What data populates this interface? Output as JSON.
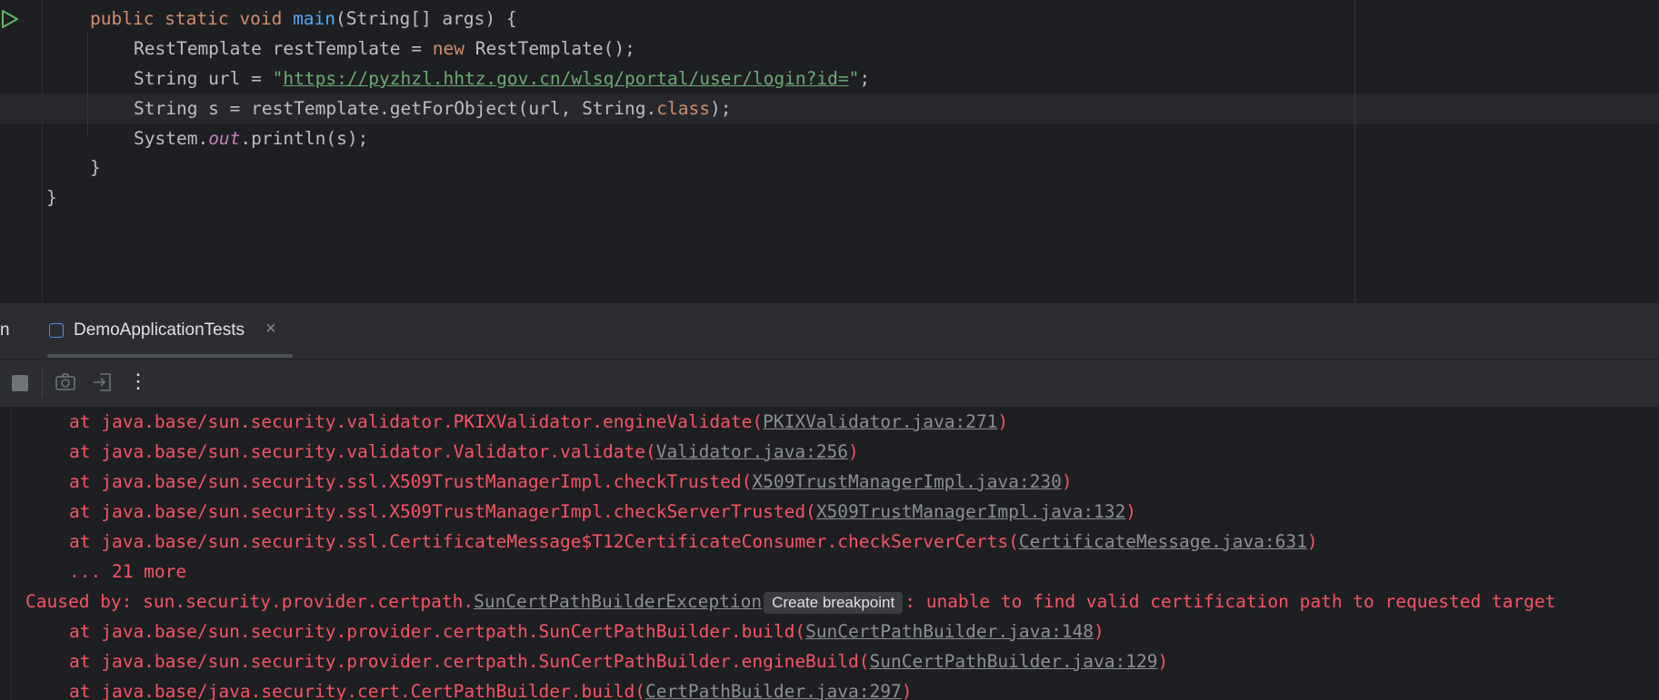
{
  "editor": {
    "lines": [
      {
        "p1": "public static void ",
        "fn": "main",
        "p2": "(String[] args) {"
      },
      {
        "p1": "RestTemplate restTemplate = ",
        "kw": "new",
        "p2": " RestTemplate();"
      },
      {
        "p1": "String url = ",
        "q1": "\"",
        "url": "https://pyzhzl.hhtz.gov.cn/wlsq/portal/user/login?id=",
        "q2": "\"",
        "p2": ";"
      },
      {
        "p1": "String s = restTemplate.getForObject(url, String.",
        "kw": "class",
        "p2": ");"
      },
      {
        "p1": "System.",
        "field": "out",
        "p2": ".println(s);"
      },
      {
        "p1": "}"
      },
      {
        "p1": "}"
      }
    ]
  },
  "run_panel": {
    "cut_tab_label": "n",
    "tab_label": "DemoApplicationTests",
    "tab_close": "×",
    "more_label": "⋮"
  },
  "console": {
    "lines": [
      {
        "pre": "at java.base/sun.security.validator.PKIXValidator.engineValidate(",
        "link": "PKIXValidator.java:271",
        "post": ")"
      },
      {
        "pre": "at java.base/sun.security.validator.Validator.validate(",
        "link": "Validator.java:256",
        "post": ")"
      },
      {
        "pre": "at java.base/sun.security.ssl.X509TrustManagerImpl.checkTrusted(",
        "link": "X509TrustManagerImpl.java:230",
        "post": ")"
      },
      {
        "pre": "at java.base/sun.security.ssl.X509TrustManagerImpl.checkServerTrusted(",
        "link": "X509TrustManagerImpl.java:132",
        "post": ")"
      },
      {
        "pre": "at java.base/sun.security.ssl.CertificateMessage$T12CertificateConsumer.checkServerCerts(",
        "link": "CertificateMessage.java:631",
        "post": ")"
      },
      {
        "pre": "... 21 more"
      },
      {
        "pre": "Caused by: sun.security.provider.certpath.",
        "link": "SunCertPathBuilderException",
        "badge": "Create breakpoint",
        "post": ": unable to find valid certification path to requested target"
      },
      {
        "pre": "at java.base/sun.security.provider.certpath.SunCertPathBuilder.build(",
        "link": "SunCertPathBuilder.java:148",
        "post": ")"
      },
      {
        "pre": "at java.base/sun.security.provider.certpath.SunCertPathBuilder.engineBuild(",
        "link": "SunCertPathBuilder.java:129",
        "post": ")"
      },
      {
        "pre": "at java.base/java.security.cert.CertPathBuilder.build(",
        "link": "CertPathBuilder.java:297",
        "post": ")"
      }
    ]
  },
  "colors": {
    "background": "#1e1f22",
    "keyword": "#cf8e6d",
    "method": "#56a8f5",
    "string": "#6aab73",
    "field": "#c77dbb",
    "error": "#f75464",
    "link": "#8c8f96"
  }
}
